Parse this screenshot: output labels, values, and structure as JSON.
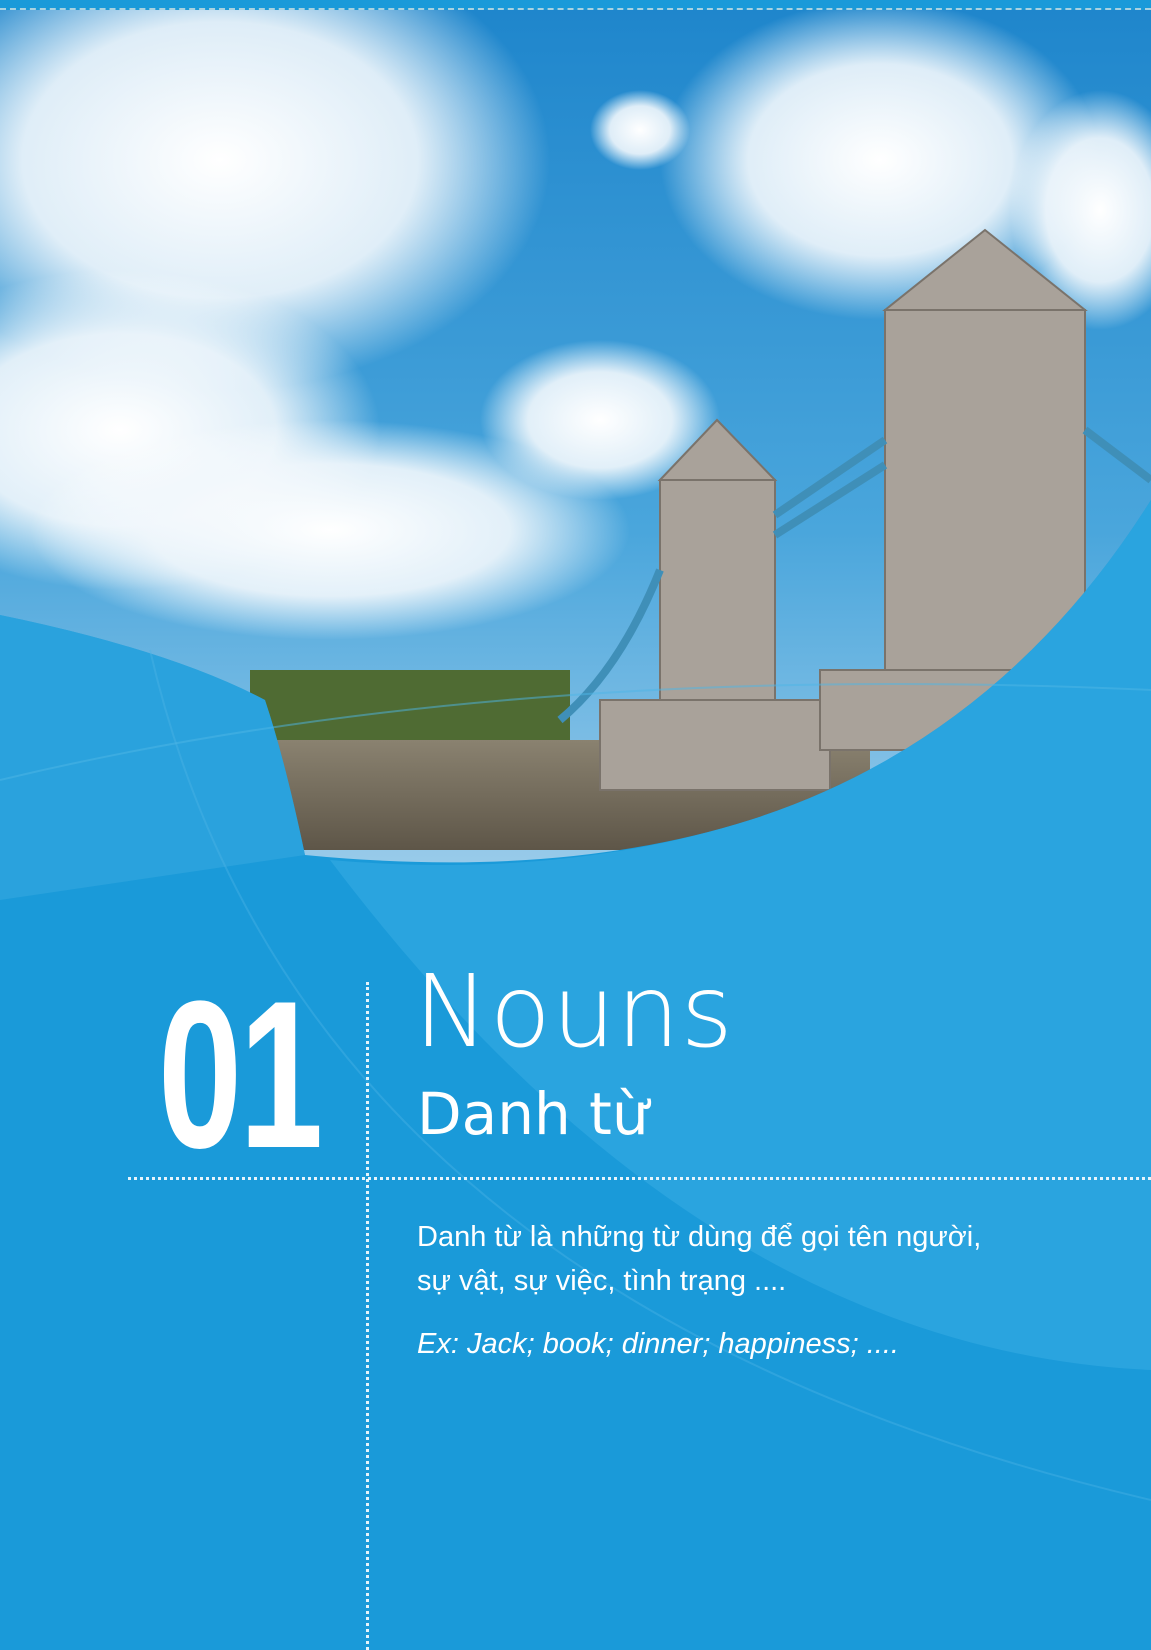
{
  "chapter": {
    "number": "01",
    "title": "Nouns",
    "subtitle": "Danh từ",
    "definition_line1": "Danh từ là những từ dùng để gọi tên người,",
    "definition_line2": "sự vật, sự việc, tình trạng ....",
    "example": "Ex: Jack; book; dinner; happiness; ...."
  },
  "colors": {
    "primary_blue": "#1a9ad9",
    "light_blue": "#2fa8e2",
    "text": "#ffffff"
  }
}
